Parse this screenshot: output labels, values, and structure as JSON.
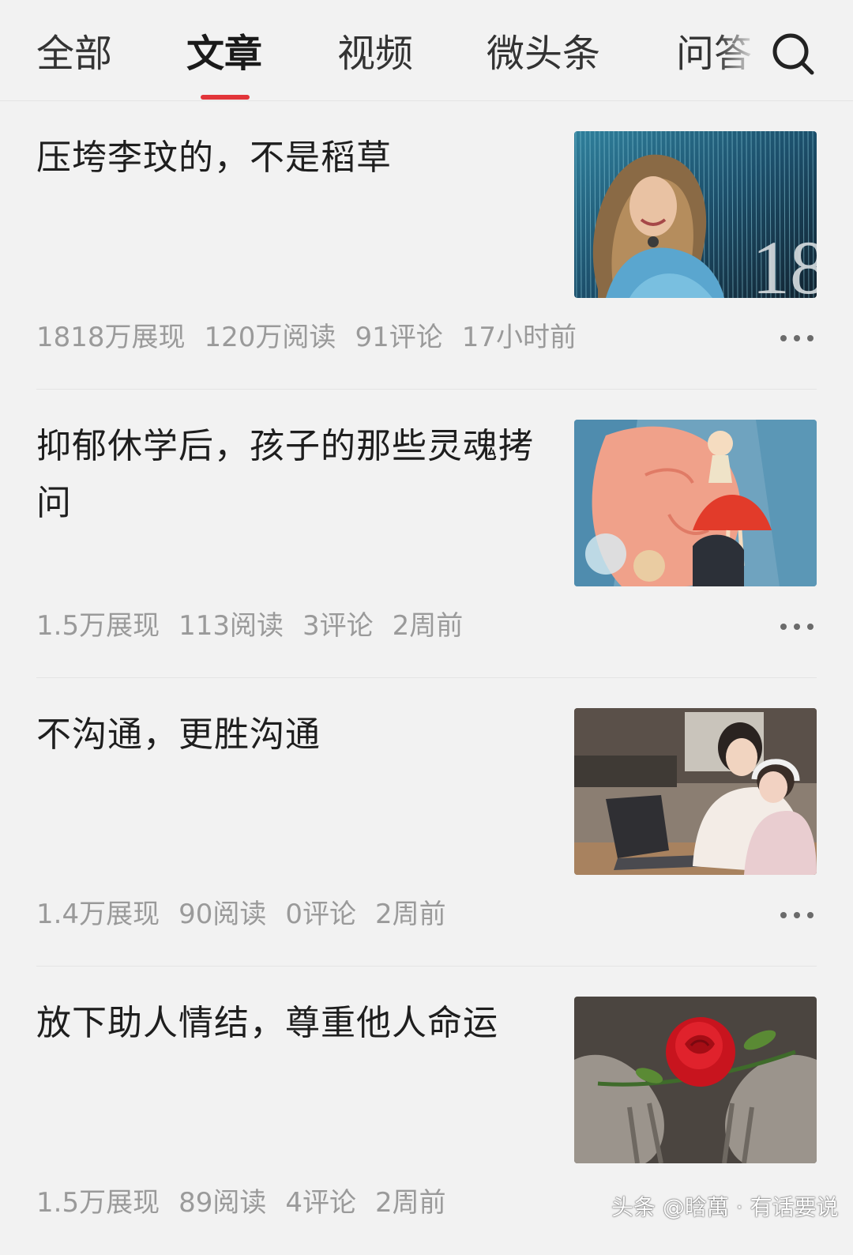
{
  "tabs": [
    {
      "label": "全部",
      "active": false
    },
    {
      "label": "文章",
      "active": true
    },
    {
      "label": "视频",
      "active": false
    },
    {
      "label": "微头条",
      "active": false
    },
    {
      "label": "问答",
      "active": false
    }
  ],
  "colors": {
    "accent": "#e2353a",
    "meta_text": "#9a9a9a",
    "background": "#f2f2f2"
  },
  "search_icon": "search-icon",
  "more_icon": "more-dots-icon",
  "articles": [
    {
      "title": "压垮李玟的，不是稻草",
      "thumbnail": "singer-photo-thumbnail",
      "impressions": "1818万展现",
      "reads": "120万阅读",
      "comments": "91评论",
      "time": "17小时前"
    },
    {
      "title": "抑郁休学后，孩子的那些灵魂拷问",
      "thumbnail": "illustration-thumbnail",
      "impressions": "1.5万展现",
      "reads": "113阅读",
      "comments": "3评论",
      "time": "2周前"
    },
    {
      "title": "不沟通，更胜沟通",
      "thumbnail": "mother-child-laptop-thumbnail",
      "impressions": "1.4万展现",
      "reads": "90阅读",
      "comments": "0评论",
      "time": "2周前"
    },
    {
      "title": "放下助人情结，尊重他人命运",
      "thumbnail": "rose-in-hands-thumbnail",
      "impressions": "1.5万展现",
      "reads": "89阅读",
      "comments": "4评论",
      "time": "2周前"
    }
  ],
  "watermark": "头条 @晗萬 · 有话要说"
}
